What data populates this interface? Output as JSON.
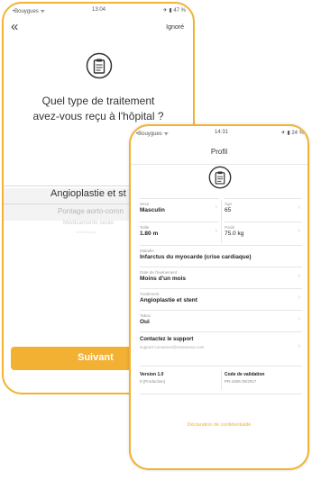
{
  "screen_question": {
    "status": {
      "carrier": "•Bouygues ᯤ",
      "time": "13:04",
      "battery": "✈ ▮ 47 %"
    },
    "nav": {
      "back_icon": "chevron-left-icon",
      "skip_label": "Ignoré"
    },
    "question": "Quel type de traitement avez-vous reçu à l'hôpital ?",
    "question_line1": "Quel type de traitement",
    "question_line2": "avez-vous reçu à l'hôpital ?",
    "picker": {
      "selected": "Angioplastie et st",
      "options": [
        "Pontage aorto-coron",
        "Médicaments seule",
        "Je ne sais pas"
      ]
    },
    "next_button": "Suivant"
  },
  "screen_profile": {
    "status": {
      "carrier": "•Bouygues ᯤ",
      "time": "14:31",
      "battery": "✈ ▮ 24 %"
    },
    "nav": {
      "title": "Profil"
    },
    "fields": {
      "sex": {
        "label": "Sexe",
        "value": "Masculin"
      },
      "age": {
        "label": "Âge",
        "value": "65"
      },
      "height": {
        "label": "Taille",
        "value": "1.80 m"
      },
      "weight": {
        "label": "Poids",
        "value": "75.0 kg"
      },
      "disease": {
        "label": "Maladie",
        "value": "Infarctus du myocarde (crise cardiaque)"
      },
      "event_date": {
        "label": "Date de l'événement",
        "value": "Moins d'un mois"
      },
      "treatment": {
        "label": "Traitement",
        "value": "Angioplastie et stent"
      },
      "smoker": {
        "label": "Tabac",
        "value": "Oui"
      }
    },
    "support": {
      "title": "Contactez le support",
      "email": "support-consumer@caranexus.com"
    },
    "version": {
      "title": "Version 1.0",
      "detail": "0 (Production)"
    },
    "validation": {
      "title": "Code de validation",
      "detail": "PR-1606 05/2017"
    },
    "privacy_link": "Déclaration de confidentialité"
  },
  "colors": {
    "accent": "#f2b233",
    "button": "#f2b133"
  }
}
